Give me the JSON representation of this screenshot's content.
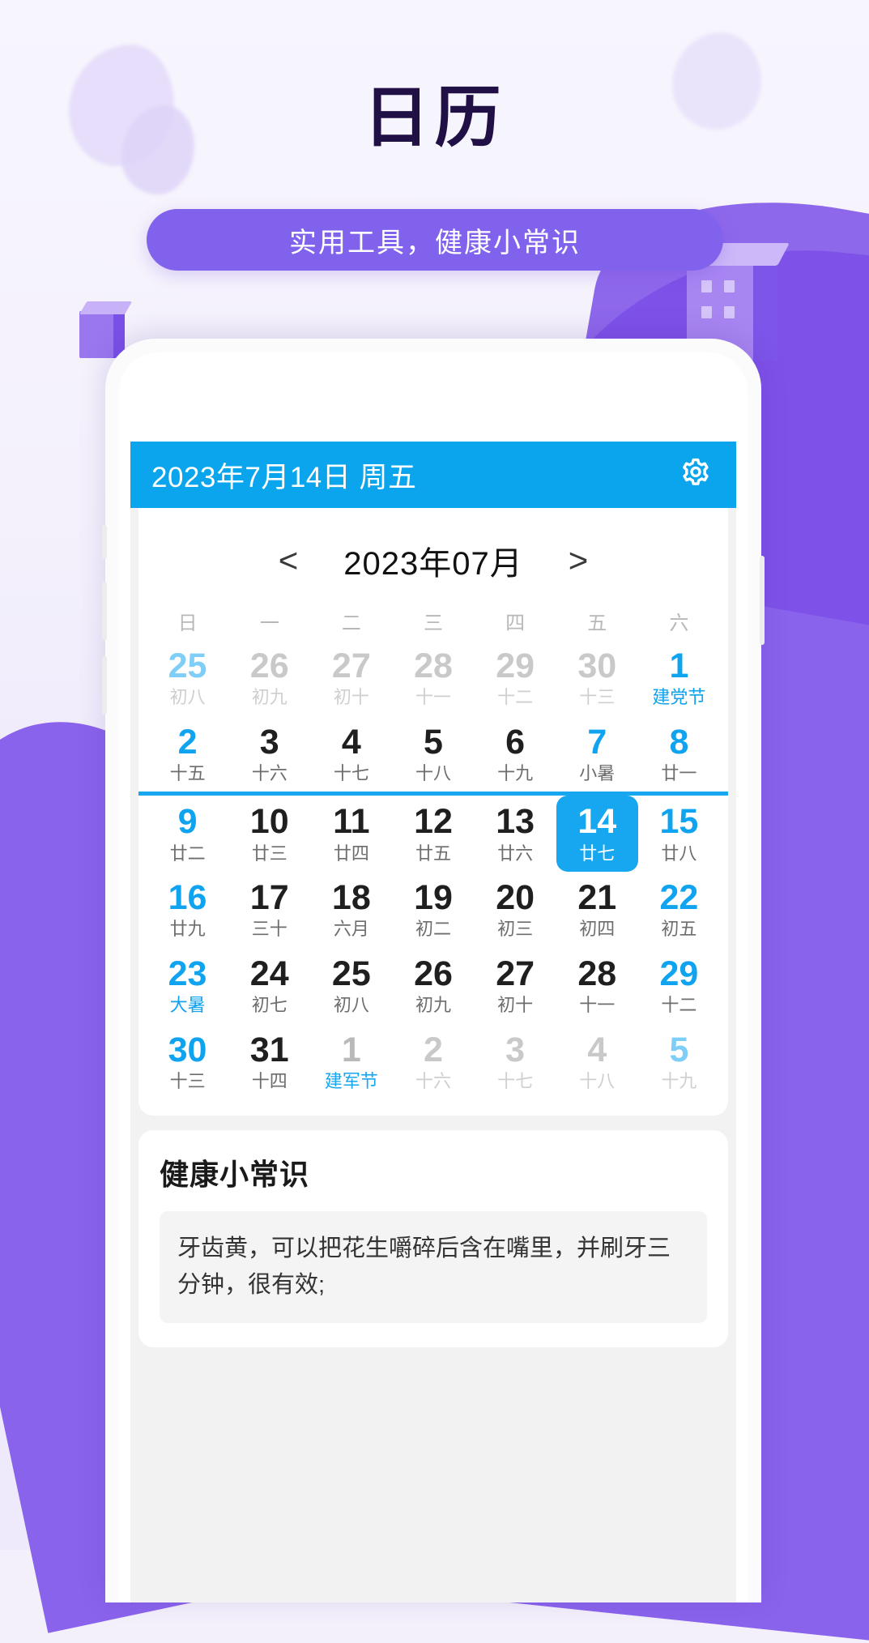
{
  "page": {
    "title": "日历",
    "subtitle": "实用工具，健康小常识",
    "accent_purple": "#8062ec",
    "accent_blue": "#0aa5ec"
  },
  "app": {
    "topbar": {
      "date_text": "2023年7月14日 周五",
      "settings_icon": "gear-icon"
    },
    "calendar": {
      "prev_label": "<",
      "month_label": "2023年07月",
      "next_label": ">",
      "weekdays": [
        "日",
        "一",
        "二",
        "三",
        "四",
        "五",
        "六"
      ],
      "weeks": [
        [
          {
            "d": "25",
            "l": "初八",
            "style": "c-mute-blue"
          },
          {
            "d": "26",
            "l": "初九",
            "style": "c-mute"
          },
          {
            "d": "27",
            "l": "初十",
            "style": "c-mute"
          },
          {
            "d": "28",
            "l": "十一",
            "style": "c-mute"
          },
          {
            "d": "29",
            "l": "十二",
            "style": "c-mute"
          },
          {
            "d": "30",
            "l": "十三",
            "style": "c-mute"
          },
          {
            "d": "1",
            "l": "建党节",
            "style": "c-blue"
          }
        ],
        [
          {
            "d": "2",
            "l": "十五",
            "style": "c-blue-lunar"
          },
          {
            "d": "3",
            "l": "十六",
            "style": "c-dark"
          },
          {
            "d": "4",
            "l": "十七",
            "style": "c-dark"
          },
          {
            "d": "5",
            "l": "十八",
            "style": "c-dark"
          },
          {
            "d": "6",
            "l": "十九",
            "style": "c-dark"
          },
          {
            "d": "7",
            "l": "小暑",
            "style": "c-blue-lunar"
          },
          {
            "d": "8",
            "l": "廿一",
            "style": "c-blue-lunar"
          }
        ],
        [
          {
            "d": "9",
            "l": "廿二",
            "style": "c-blue-lunar"
          },
          {
            "d": "10",
            "l": "廿三",
            "style": "c-dark"
          },
          {
            "d": "11",
            "l": "廿四",
            "style": "c-dark"
          },
          {
            "d": "12",
            "l": "廿五",
            "style": "c-dark"
          },
          {
            "d": "13",
            "l": "廿六",
            "style": "c-dark"
          },
          {
            "d": "14",
            "l": "廿七",
            "style": "c-sel"
          },
          {
            "d": "15",
            "l": "廿八",
            "style": "c-blue-lunar"
          }
        ],
        [
          {
            "d": "16",
            "l": "廿九",
            "style": "c-blue-lunar"
          },
          {
            "d": "17",
            "l": "三十",
            "style": "c-dark"
          },
          {
            "d": "18",
            "l": "六月",
            "style": "c-dark"
          },
          {
            "d": "19",
            "l": "初二",
            "style": "c-dark"
          },
          {
            "d": "20",
            "l": "初三",
            "style": "c-dark"
          },
          {
            "d": "21",
            "l": "初四",
            "style": "c-dark"
          },
          {
            "d": "22",
            "l": "初五",
            "style": "c-blue-lunar"
          }
        ],
        [
          {
            "d": "23",
            "l": "大暑",
            "style": "c-blue"
          },
          {
            "d": "24",
            "l": "初七",
            "style": "c-dark"
          },
          {
            "d": "25",
            "l": "初八",
            "style": "c-dark"
          },
          {
            "d": "26",
            "l": "初九",
            "style": "c-dark"
          },
          {
            "d": "27",
            "l": "初十",
            "style": "c-dark"
          },
          {
            "d": "28",
            "l": "十一",
            "style": "c-dark"
          },
          {
            "d": "29",
            "l": "十二",
            "style": "c-blue-lunar"
          }
        ],
        [
          {
            "d": "30",
            "l": "十三",
            "style": "c-blue-lunar"
          },
          {
            "d": "31",
            "l": "十四",
            "style": "c-dark"
          },
          {
            "d": "1",
            "l": "建军节",
            "style": "c-mute-blue-holiday"
          },
          {
            "d": "2",
            "l": "十六",
            "style": "c-mute"
          },
          {
            "d": "3",
            "l": "十七",
            "style": "c-mute"
          },
          {
            "d": "4",
            "l": "十八",
            "style": "c-mute"
          },
          {
            "d": "5",
            "l": "十九",
            "style": "c-mute-blue"
          }
        ]
      ]
    },
    "health_tips": {
      "title": "健康小常识",
      "items": [
        "牙齿黄，可以把花生嚼碎后含在嘴里，并刷牙三分钟，很有效;"
      ]
    }
  }
}
